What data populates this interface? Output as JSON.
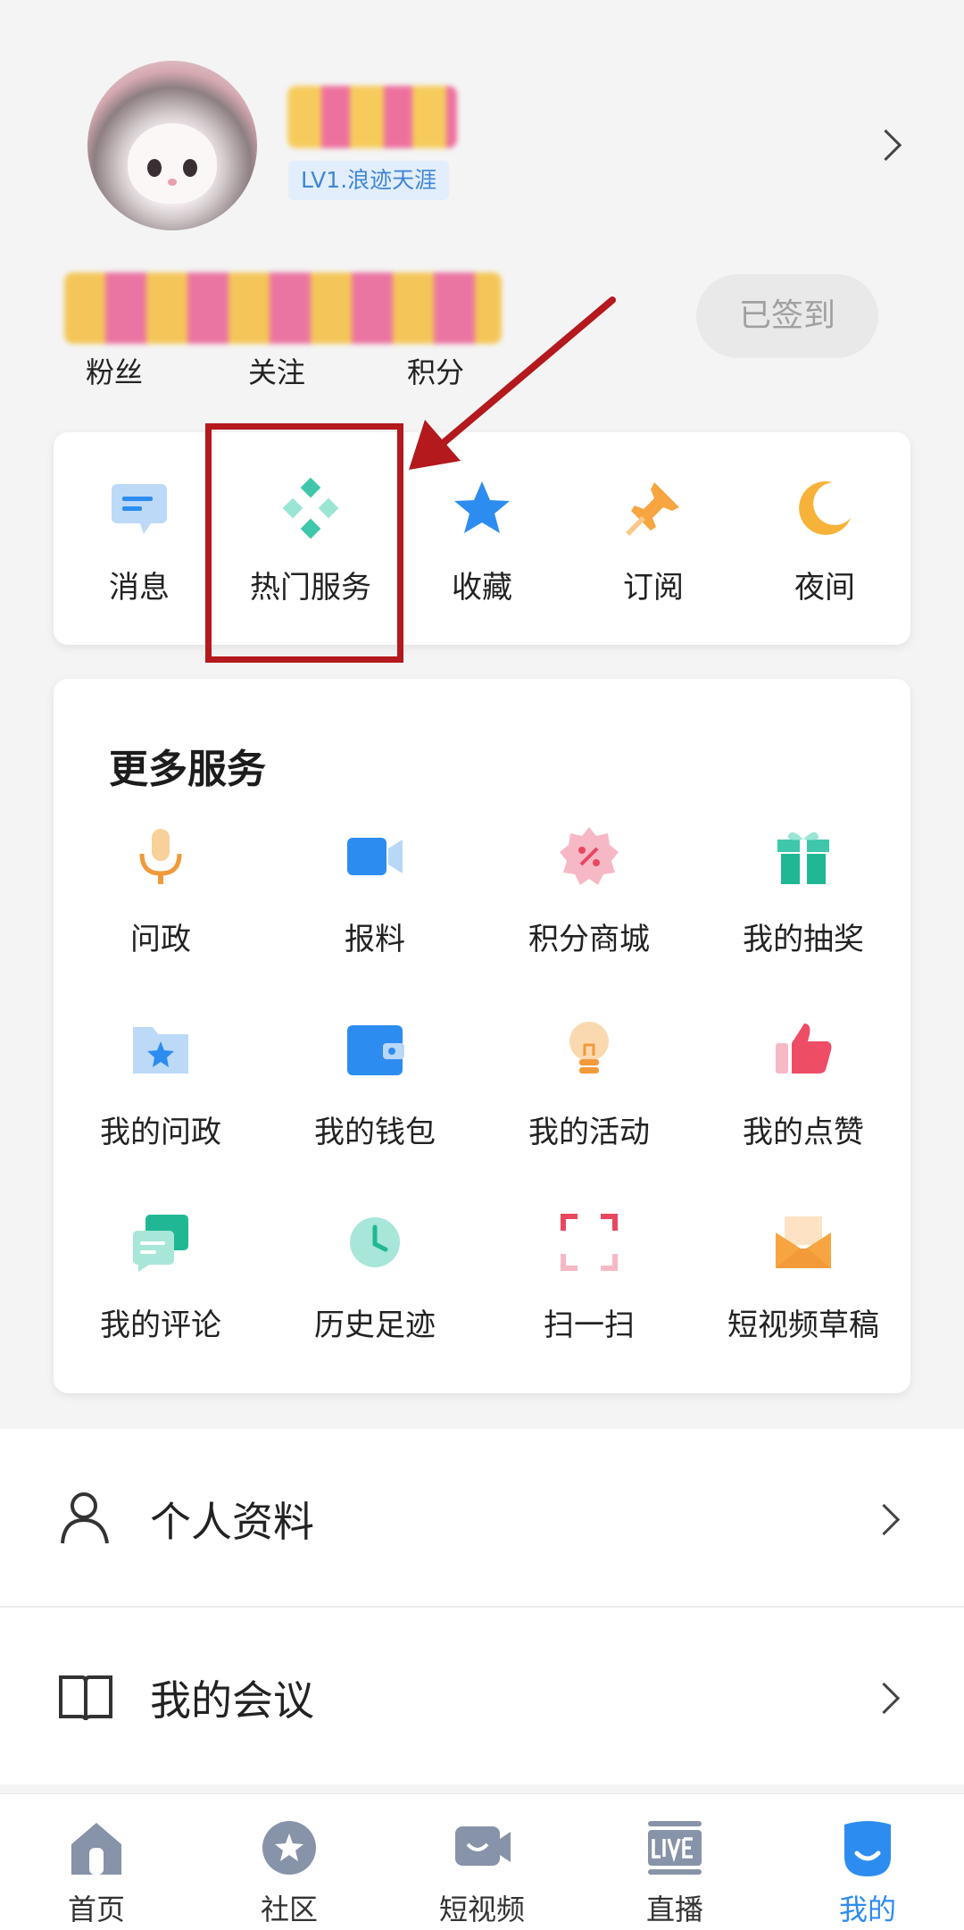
{
  "profile": {
    "level": "LV1.浪迹天涯",
    "stats": [
      {
        "label": "粉丝"
      },
      {
        "label": "关注"
      },
      {
        "label": "积分"
      }
    ],
    "signed_label": "已签到"
  },
  "quick_actions": [
    {
      "label": "消息",
      "icon": "message-icon"
    },
    {
      "label": "热门服务",
      "icon": "hot-services-icon"
    },
    {
      "label": "收藏",
      "icon": "star-icon"
    },
    {
      "label": "订阅",
      "icon": "pin-icon"
    },
    {
      "label": "夜间",
      "icon": "moon-icon"
    }
  ],
  "more_services": {
    "title": "更多服务",
    "items": [
      {
        "label": "问政",
        "icon": "microphone-icon"
      },
      {
        "label": "报料",
        "icon": "video-camera-icon"
      },
      {
        "label": "积分商城",
        "icon": "points-mall-icon"
      },
      {
        "label": "我的抽奖",
        "icon": "gift-icon"
      },
      {
        "label": "我的问政",
        "icon": "folder-star-icon"
      },
      {
        "label": "我的钱包",
        "icon": "wallet-icon"
      },
      {
        "label": "我的活动",
        "icon": "lightbulb-icon"
      },
      {
        "label": "我的点赞",
        "icon": "thumbs-up-icon"
      },
      {
        "label": "我的评论",
        "icon": "comment-icon"
      },
      {
        "label": "历史足迹",
        "icon": "clock-icon"
      },
      {
        "label": "扫一扫",
        "icon": "scan-icon"
      },
      {
        "label": "短视频草稿",
        "icon": "envelope-icon"
      }
    ]
  },
  "list_rows": [
    {
      "label": "个人资料",
      "icon": "person-icon"
    },
    {
      "label": "我的会议",
      "icon": "book-icon"
    }
  ],
  "tabbar": {
    "active_index": 4,
    "tabs": [
      {
        "label": "首页",
        "icon": "home-icon"
      },
      {
        "label": "社区",
        "icon": "community-icon"
      },
      {
        "label": "短视频",
        "icon": "short-video-icon"
      },
      {
        "label": "直播",
        "icon": "live-icon"
      },
      {
        "label": "我的",
        "icon": "mine-icon"
      }
    ]
  },
  "colors": {
    "accent_blue": "#2d8cf0",
    "annotation_red": "#b3191d",
    "signed_bg": "#e9e9e9"
  }
}
